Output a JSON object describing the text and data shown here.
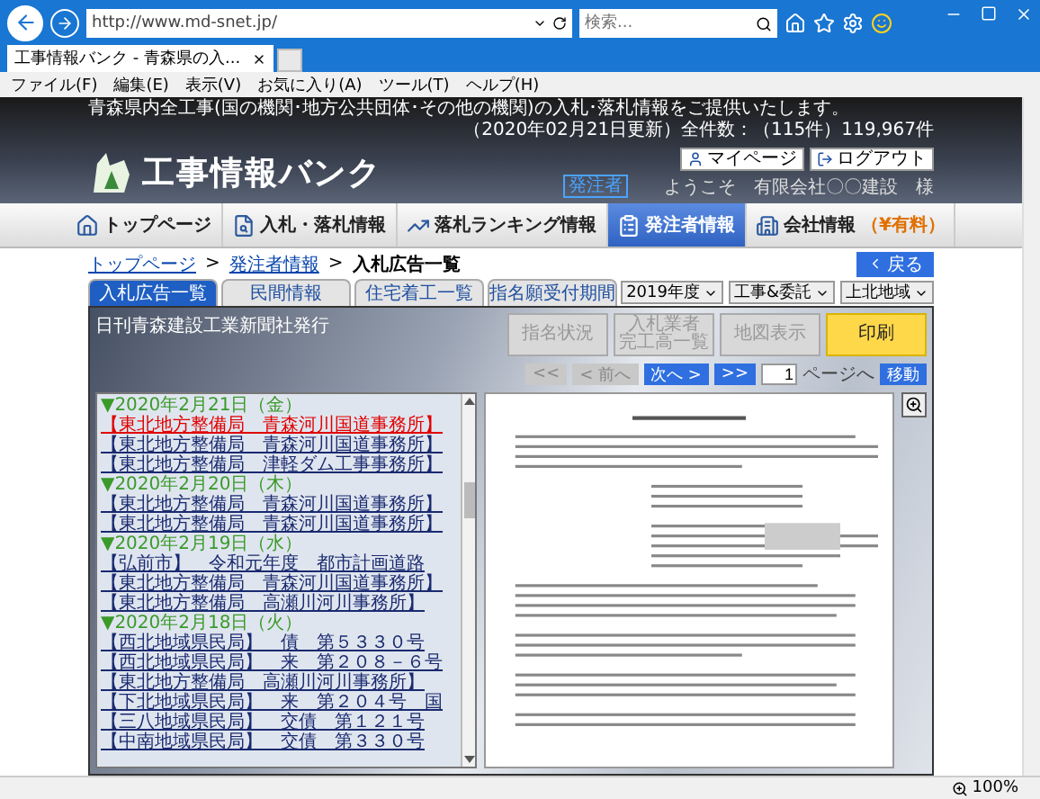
{
  "browser": {
    "url": "http://www.md-snet.jp/",
    "search_placeholder": "検索...",
    "tab_title": "工事情報バンク - 青森県の入...",
    "menu": [
      "ファイル(F)",
      "編集(E)",
      "表示(V)",
      "お気に入り(A)",
      "ツール(T)",
      "ヘルプ(H)"
    ],
    "zoom": "100%"
  },
  "site": {
    "notice": "青森県内全工事(国の機関･地方公共団体･その他の機関)の入札･落札情報をご提供いたします。",
    "update": "（2020年02月21日更新）全件数：（115件）119,967件",
    "logo": "工事情報バンク",
    "my_page": "マイページ",
    "logout": "ログアウト",
    "badge": "発注者",
    "welcome": "ようこそ　有限会社〇〇建設　様"
  },
  "nav": [
    {
      "label": "トップページ",
      "selected": false
    },
    {
      "label": "入札・落札情報",
      "selected": false
    },
    {
      "label": "落札ランキング情報",
      "selected": false
    },
    {
      "label": "発注者情報",
      "selected": true
    },
    {
      "label": "会社情報",
      "note": "（¥有料）",
      "selected": false
    }
  ],
  "breadcrumb": [
    "トップページ",
    "発注者情報",
    "入札広告一覧"
  ],
  "breadcrumb_separator": ">",
  "back": "戻る",
  "tabs": [
    {
      "label": "入札広告一覧",
      "selected": true
    },
    {
      "label": "民間情報",
      "selected": false
    },
    {
      "label": "住宅着工一覧",
      "selected": false
    },
    {
      "label": "指名願受付期間",
      "selected": false
    }
  ],
  "filters": [
    "2019年度",
    "工事&委託",
    "上北地域"
  ],
  "panel": {
    "publisher": "日刊青森建設工業新聞社発行",
    "actions": [
      {
        "lines": [
          "指名状況"
        ],
        "kind": "normal",
        "disabled": true
      },
      {
        "lines": [
          "入札業者",
          "完工高一覧"
        ],
        "kind": "normal",
        "disabled": true
      },
      {
        "lines": [
          "地図表示"
        ],
        "kind": "normal",
        "disabled": true
      },
      {
        "lines": [
          "印刷"
        ],
        "kind": "print",
        "disabled": false
      }
    ],
    "pager": [
      {
        "label": "<<",
        "disabled": true
      },
      {
        "label": "< 前へ",
        "disabled": true
      },
      {
        "label": "次へ >",
        "disabled": false
      },
      {
        "label": ">>",
        "disabled": false
      }
    ],
    "page": "1",
    "page_label": "ページへ",
    "go": "移動"
  },
  "list": [
    {
      "date": "▼2020年2月21日（金）",
      "items": [
        {
          "text": "【東北地方整備局　青森河川国道事務所】",
          "selected": true
        },
        {
          "text": "【東北地方整備局　青森河川国道事務所】",
          "selected": false
        },
        {
          "text": "【東北地方整備局　津軽ダム工事事務所】",
          "selected": false
        }
      ]
    },
    {
      "date": "▼2020年2月20日（木）",
      "items": [
        {
          "text": "【東北地方整備局　青森河川国道事務所】",
          "selected": false
        },
        {
          "text": "【東北地方整備局　青森河川国道事務所】",
          "selected": false
        }
      ]
    },
    {
      "date": "▼2020年2月19日（水）",
      "items": [
        {
          "text": "【弘前市】　令和元年度　都市計画道路",
          "selected": false
        },
        {
          "text": "【東北地方整備局　青森河川国道事務所】",
          "selected": false
        },
        {
          "text": "【東北地方整備局　高瀬川河川事務所】",
          "selected": false
        }
      ]
    },
    {
      "date": "▼2020年2月18日（火）",
      "items": [
        {
          "text": "【西北地域県民局】　債　第５３３０号",
          "selected": false
        },
        {
          "text": "【西北地域県民局】　来　第２０８－６号",
          "selected": false
        },
        {
          "text": "【東北地方整備局　高瀬川河川事務所】",
          "selected": false
        },
        {
          "text": "【下北地域県民局】　来　第２０４号　国",
          "selected": false
        },
        {
          "text": "【三八地域県民局】　交債　第１２１号",
          "selected": false
        },
        {
          "text": "【中南地域県民局】　交債　第３３０号",
          "selected": false
        }
      ]
    }
  ]
}
